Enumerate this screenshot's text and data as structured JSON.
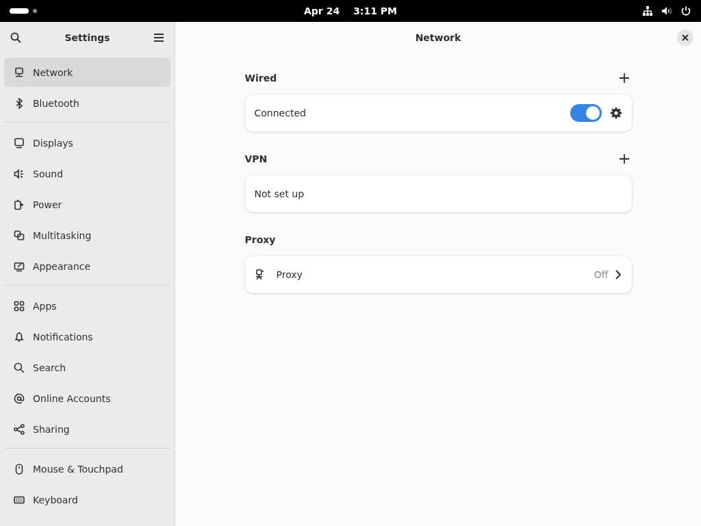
{
  "top_bar": {
    "date": "Apr 24",
    "time": "3:11 PM"
  },
  "sidebar": {
    "title": "Settings",
    "groups": [
      [
        {
          "label": "Network",
          "selected": true
        },
        {
          "label": "Bluetooth",
          "selected": false
        }
      ],
      [
        {
          "label": "Displays",
          "selected": false
        },
        {
          "label": "Sound",
          "selected": false
        },
        {
          "label": "Power",
          "selected": false
        },
        {
          "label": "Multitasking",
          "selected": false
        },
        {
          "label": "Appearance",
          "selected": false
        }
      ],
      [
        {
          "label": "Apps",
          "selected": false
        },
        {
          "label": "Notifications",
          "selected": false
        },
        {
          "label": "Search",
          "selected": false
        },
        {
          "label": "Online Accounts",
          "selected": false
        },
        {
          "label": "Sharing",
          "selected": false
        }
      ],
      [
        {
          "label": "Mouse & Touchpad",
          "selected": false
        },
        {
          "label": "Keyboard",
          "selected": false
        }
      ]
    ]
  },
  "page": {
    "title": "Network",
    "wired": {
      "title": "Wired",
      "rows": [
        {
          "label": "Connected",
          "on": true
        }
      ]
    },
    "vpn": {
      "title": "VPN",
      "status": "Not set up"
    },
    "proxy": {
      "title": "Proxy",
      "label": "Proxy",
      "status": "Off"
    }
  }
}
